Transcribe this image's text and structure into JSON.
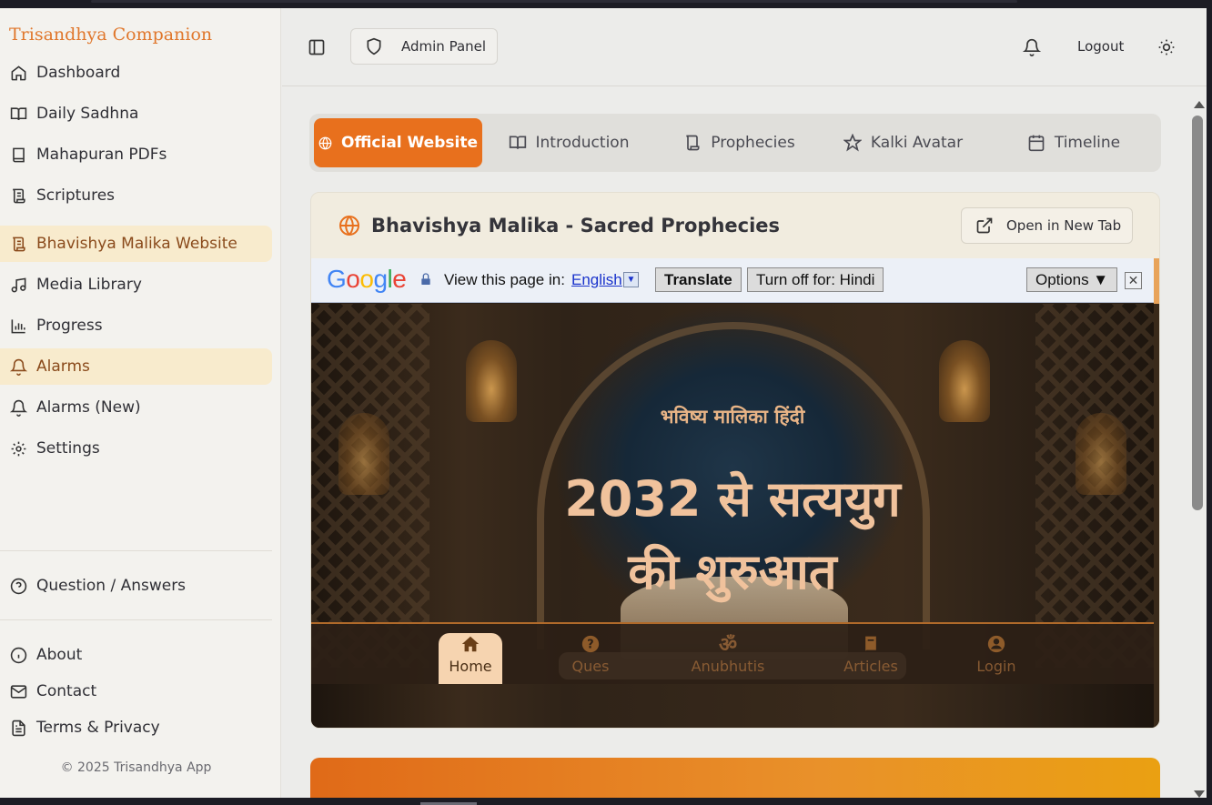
{
  "app": {
    "brand": "Trisandhya Companion"
  },
  "sidebar": {
    "items": [
      {
        "label": "Dashboard",
        "icon": "home-icon"
      },
      {
        "label": "Daily Sadhna",
        "icon": "book-open-icon"
      },
      {
        "label": "Mahapuran PDFs",
        "icon": "book-icon"
      },
      {
        "label": "Scriptures",
        "icon": "scroll-icon"
      },
      {
        "label": "Bhavishya Malika Website",
        "icon": "scroll-icon",
        "active": true
      },
      {
        "label": "Media Library",
        "icon": "music-icon"
      },
      {
        "label": "Progress",
        "icon": "bar-chart-icon"
      },
      {
        "label": "Alarms",
        "icon": "bell-icon",
        "active": true
      },
      {
        "label": "Alarms (New)",
        "icon": "bell-icon"
      },
      {
        "label": "Settings",
        "icon": "gear-icon"
      }
    ],
    "qa": "Question / Answers",
    "footer_items": [
      "About",
      "Contact",
      "Terms & Privacy"
    ],
    "copyright": "© 2025 Trisandhya App"
  },
  "header": {
    "admin_label": "Admin Panel",
    "logout_label": "Logout"
  },
  "tabs": [
    {
      "label": "Official Website",
      "icon": "globe-icon",
      "active": true
    },
    {
      "label": "Introduction",
      "icon": "book-open-icon"
    },
    {
      "label": "Prophecies",
      "icon": "scroll-icon"
    },
    {
      "label": "Kalki Avatar",
      "icon": "star-icon"
    },
    {
      "label": "Timeline",
      "icon": "calendar-icon"
    }
  ],
  "card": {
    "title": "Bhavishya Malika - Sacred Prophecies",
    "open_label": "Open in New Tab"
  },
  "google_bar": {
    "logo": "Google",
    "view_text": "View this page in:",
    "language": "English",
    "translate": "Translate",
    "turn_off": "Turn off for: Hindi",
    "options": "Options ▼",
    "close": "✕"
  },
  "hero": {
    "subtitle": "भविष्य मालिका हिंदी",
    "title_line1": "2032 से सत्ययुग",
    "title_line2": "की शुरुआत"
  },
  "bottom_nav": [
    {
      "label": "Home",
      "icon": "home-icon",
      "active": true
    },
    {
      "label": "Ques",
      "icon": "question-icon"
    },
    {
      "label": "Anubhutis",
      "icon": "om-icon",
      "glyph": "ॐ"
    },
    {
      "label": "Articles",
      "icon": "book-icon"
    },
    {
      "label": "Login",
      "icon": "user-icon"
    }
  ],
  "colors": {
    "accent": "#e8701d",
    "brand": "#e0772c",
    "active_bg": "#f8ebcd",
    "active_text": "#8a4a1b"
  }
}
